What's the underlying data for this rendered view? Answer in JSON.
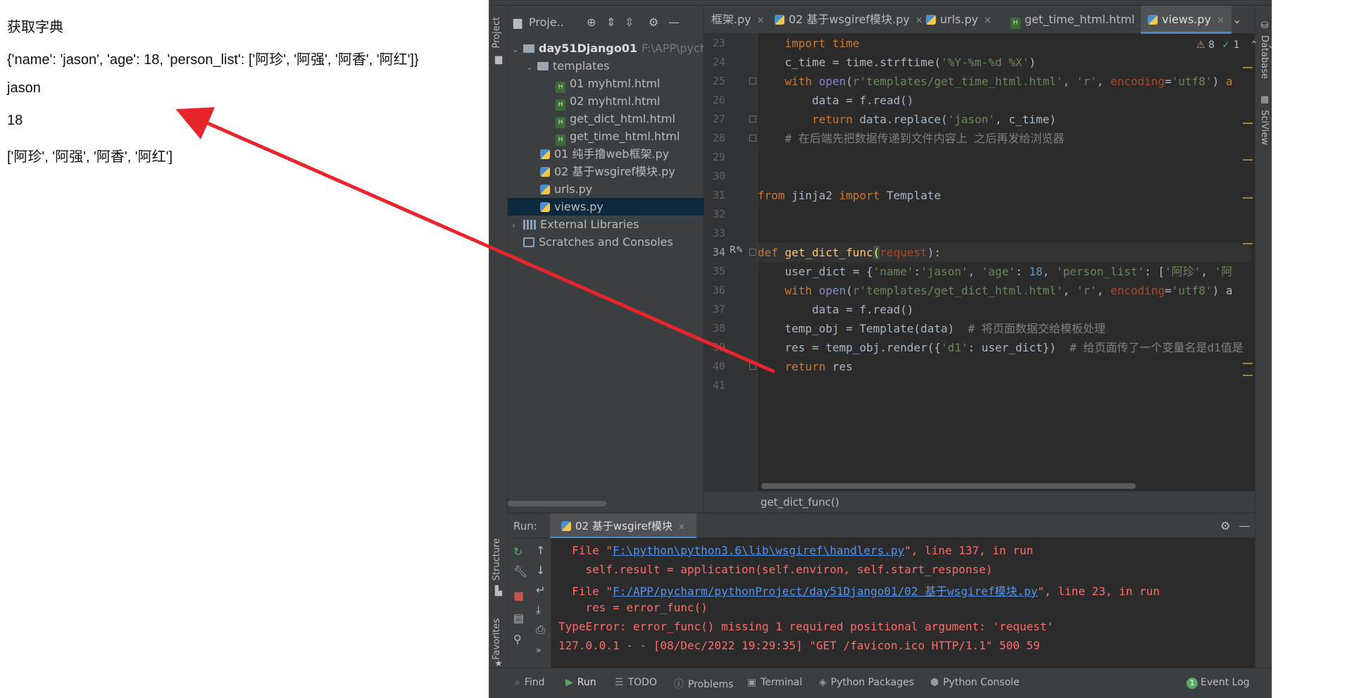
{
  "browser": {
    "heading": "获取字典",
    "dict_line": "{'name': 'jason', 'age': 18, 'person_list': ['阿珍', '阿强', '阿香', '阿红']}",
    "name_line": "jason",
    "age_line": "18",
    "list_line": "['阿珍', '阿强', '阿香', '阿红']"
  },
  "ide": {
    "left_tools": {
      "project": "Project",
      "structure": "Structure",
      "favorites": "Favorites"
    },
    "right_tools": {
      "database": "Database",
      "sciview": "SciView"
    },
    "project_toolbar": {
      "label": "Proje.."
    },
    "tree": {
      "root": "day51Django01",
      "root_path": "F:\\APP\\pychar",
      "templates": "templates",
      "files": [
        "01 myhtml.html",
        "02 myhtml.html",
        "get_dict_html.html",
        "get_time_html.html"
      ],
      "pyfiles": [
        "01 纯手撸web框架.py",
        "02 基于wsgiref模块.py",
        "urls.py",
        "views.py"
      ],
      "external": "External Libraries",
      "scratches": "Scratches and Consoles"
    },
    "tabs": [
      {
        "label": "框架.py"
      },
      {
        "label": "02 基于wsgiref模块.py"
      },
      {
        "label": "urls.py"
      },
      {
        "label": "get_time_html.html"
      },
      {
        "label": "views.py"
      }
    ],
    "inspections": {
      "warnings": "8",
      "ok": "1"
    },
    "line_numbers": [
      "23",
      "24",
      "25",
      "26",
      "27",
      "28",
      "29",
      "30",
      "31",
      "32",
      "33",
      "34",
      "35",
      "36",
      "37",
      "38",
      "39",
      "40",
      "41"
    ],
    "code": {
      "l23": "    import time",
      "l24a": "    c_time = time.strftime(",
      "l24b": "'%Y-%m-%d %X'",
      "l24c": ")",
      "l25a": "    ",
      "l25b": "with",
      "l25c": " ",
      "l25d": "open",
      "l25e": "(",
      "l25f": "r'templates/get_time_html.html'",
      "l25g": ", ",
      "l25h": "'r'",
      "l25i": ", ",
      "l25j": "encoding",
      "l25k": "=",
      "l25l": "'utf8'",
      "l25m": ") ",
      "l25n": "a",
      "l26": "        data = f.read()",
      "l27a": "        ",
      "l27b": "return",
      "l27c": " data.replace(",
      "l27d": "'jason'",
      "l27e": ", c_time)",
      "l28": "    # 在后端先把数据传递到文件内容上 之后再发给浏览器",
      "l31a": "from",
      "l31b": " jinja2 ",
      "l31c": "import",
      "l31d": " Template",
      "l34a": "def",
      "l34b": " ",
      "l34c": "get_dict_func",
      "l34d": "(",
      "l34e": "request",
      "l34f": "):",
      "l35a": "    user_dict = {",
      "l35b": "'name'",
      "l35c": ":",
      "l35d": "'jason'",
      "l35e": ", ",
      "l35f": "'age'",
      "l35g": ": ",
      "l35h": "18",
      "l35i": ", ",
      "l35j": "'person_list'",
      "l35k": ": [",
      "l35l": "'阿珍'",
      "l35m": ", ",
      "l35n": "'阿",
      "l36a": "    ",
      "l36b": "with",
      "l36c": " ",
      "l36d": "open",
      "l36e": "(",
      "l36f": "r'templates/get_dict_html.html'",
      "l36g": ", ",
      "l36h": "'r'",
      "l36i": ", ",
      "l36j": "encoding",
      "l36k": "=",
      "l36l": "'utf8'",
      "l36m": ") a",
      "l37": "        data = f.read()",
      "l38a": "    temp_obj = Template(data)  ",
      "l38b": "# 将页面数据交给模板处理",
      "l39a": "    res = temp_obj.render({",
      "l39b": "'d1'",
      "l39c": ": user_dict})  ",
      "l39d": "# 给页面传了一个变量名是d1值是",
      "l40a": "    ",
      "l40b": "return",
      "l40c": " res"
    },
    "breadcrumb": "get_dict_func()",
    "run": {
      "label": "Run:",
      "tab": "02 基于wsgiref模块",
      "lines": {
        "l1a": "  File \"",
        "l1b": "F:\\python\\python3.6\\lib\\wsgiref\\handlers.py",
        "l1c": "\", line 137, in run",
        "l2": "    self.result = application(self.environ, self.start_response)",
        "l3a": "  File \"",
        "l3b": "F:/APP/pycharm/pythonProject/day51Django01/02 基于wsgiref模块.py",
        "l3c": "\", line 23, in run",
        "l4": "    res = error_func()",
        "l5": "TypeError: error_func() missing 1 required positional argument: 'request'",
        "l6": "127.0.0.1 - - [08/Dec/2022 19:29:35] \"GET /favicon.ico HTTP/1.1\" 500 59"
      }
    },
    "bottom": {
      "find": "Find",
      "run": "Run",
      "todo": "TODO",
      "problems": "Problems",
      "terminal": "Terminal",
      "packages": "Python Packages",
      "console": "Python Console",
      "eventlog": "Event Log",
      "eventlog_count": "1"
    }
  },
  "colors": {
    "arrow": "#e8252b",
    "accent": "#4a88c7"
  }
}
